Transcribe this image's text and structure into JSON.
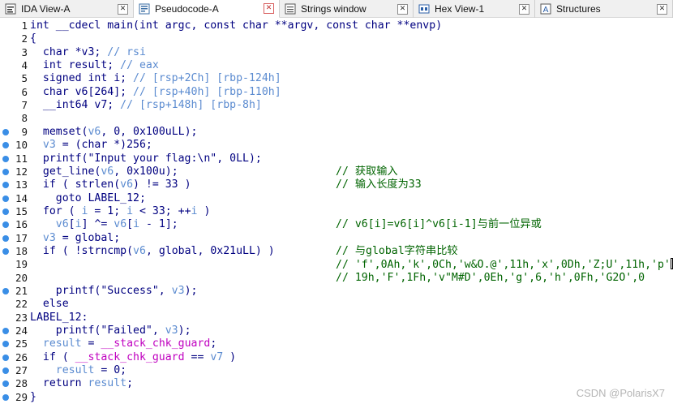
{
  "tabs": [
    {
      "label": "IDA View-A",
      "icon": "ida-view-icon",
      "close": "✕",
      "active": false
    },
    {
      "label": "Pseudocode-A",
      "icon": "pseudocode-icon",
      "close": "✕",
      "active": true
    },
    {
      "label": "Strings window",
      "icon": "strings-icon",
      "close": "✕",
      "active": false
    },
    {
      "label": "Hex View-1",
      "icon": "hex-view-icon",
      "close": "✕",
      "active": false
    },
    {
      "label": "Structures",
      "icon": "structures-icon",
      "close": "✕",
      "active": false
    }
  ],
  "code": {
    "lines": [
      {
        "n": "1",
        "bp": false,
        "parts": [
          [
            "kw",
            "int __cdecl main(int argc, const char **argv, const char **envp)"
          ]
        ]
      },
      {
        "n": "2",
        "bp": false,
        "parts": [
          [
            "kw",
            "{"
          ]
        ]
      },
      {
        "n": "3",
        "bp": false,
        "parts": [
          [
            "kw",
            "  char *v3; "
          ],
          [
            "cm",
            "// rsi"
          ]
        ]
      },
      {
        "n": "4",
        "bp": false,
        "parts": [
          [
            "kw",
            "  int result; "
          ],
          [
            "cm",
            "// eax"
          ]
        ]
      },
      {
        "n": "5",
        "bp": false,
        "parts": [
          [
            "kw",
            "  signed int i; "
          ],
          [
            "cm",
            "// [rsp+2Ch] [rbp-124h]"
          ]
        ]
      },
      {
        "n": "6",
        "bp": false,
        "parts": [
          [
            "kw",
            "  char v6[264]; "
          ],
          [
            "cm",
            "// [rsp+40h] [rbp-110h]"
          ]
        ]
      },
      {
        "n": "7",
        "bp": false,
        "parts": [
          [
            "kw",
            "  __int64 v7; "
          ],
          [
            "cm",
            "// [rsp+148h] [rbp-8h]"
          ]
        ]
      },
      {
        "n": "8",
        "bp": false,
        "parts": [
          [
            "kw",
            ""
          ]
        ]
      },
      {
        "n": "9",
        "bp": true,
        "parts": [
          [
            "kw",
            "  memset("
          ],
          [
            "var",
            "v6"
          ],
          [
            "kw",
            ", 0, 0x100uLL);"
          ]
        ]
      },
      {
        "n": "10",
        "bp": true,
        "parts": [
          [
            "kw",
            "  "
          ],
          [
            "var",
            "v3"
          ],
          [
            "kw",
            " = (char *)256;"
          ]
        ]
      },
      {
        "n": "11",
        "bp": true,
        "parts": [
          [
            "kw",
            "  printf(\"Input your flag:\\n\", 0LL);"
          ]
        ]
      },
      {
        "n": "12",
        "bp": true,
        "parts": [
          [
            "kw",
            "  get_line("
          ],
          [
            "var",
            "v6"
          ],
          [
            "kw",
            ", 0x100u);"
          ]
        ],
        "comment": "// 获取输入"
      },
      {
        "n": "13",
        "bp": true,
        "parts": [
          [
            "kw",
            "  if ( strlen("
          ],
          [
            "var",
            "v6"
          ],
          [
            "kw",
            ") != 33 )"
          ]
        ],
        "comment": "// 输入长度为33"
      },
      {
        "n": "14",
        "bp": true,
        "parts": [
          [
            "kw",
            "    goto LABEL_12;"
          ]
        ]
      },
      {
        "n": "15",
        "bp": true,
        "parts": [
          [
            "kw",
            "  for ( "
          ],
          [
            "var",
            "i"
          ],
          [
            "kw",
            " = 1; "
          ],
          [
            "var",
            "i"
          ],
          [
            "kw",
            " < 33; ++"
          ],
          [
            "var",
            "i"
          ],
          [
            "kw",
            " )"
          ]
        ]
      },
      {
        "n": "16",
        "bp": true,
        "parts": [
          [
            "kw",
            "    "
          ],
          [
            "var",
            "v6"
          ],
          [
            "kw",
            "["
          ],
          [
            "var",
            "i"
          ],
          [
            "kw",
            "] ^= "
          ],
          [
            "var",
            "v6"
          ],
          [
            "kw",
            "["
          ],
          [
            "var",
            "i"
          ],
          [
            "kw",
            " - 1];"
          ]
        ],
        "comment": "// v6[i]=v6[i]^v6[i-1]与前一位异或"
      },
      {
        "n": "17",
        "bp": true,
        "parts": [
          [
            "kw",
            "  "
          ],
          [
            "var",
            "v3"
          ],
          [
            "kw",
            " = global;"
          ]
        ]
      },
      {
        "n": "18",
        "bp": true,
        "parts": [
          [
            "kw",
            "  if ( !strncmp("
          ],
          [
            "var",
            "v6"
          ],
          [
            "kw",
            ", global, 0x21uLL) )"
          ]
        ],
        "comment": "// 与global字符串比较"
      },
      {
        "n": "19",
        "bp": false,
        "parts": [
          [
            "kw",
            ""
          ]
        ],
        "comment": "// 'f',0Ah,'k',0Ch,'w&O.@',11h,'x',0Dh,'Z;U',11h,'p'",
        "cursor": true
      },
      {
        "n": "20",
        "bp": false,
        "parts": [
          [
            "kw",
            ""
          ]
        ],
        "comment": "// 19h,'F',1Fh,'v\"M#D',0Eh,'g',6,'h',0Fh,'G2O',0"
      },
      {
        "n": "21",
        "bp": true,
        "parts": [
          [
            "kw",
            "    printf(\"Success\", "
          ],
          [
            "var",
            "v3"
          ],
          [
            "kw",
            ");"
          ]
        ]
      },
      {
        "n": "22",
        "bp": false,
        "parts": [
          [
            "kw",
            "  else"
          ]
        ]
      },
      {
        "n": "23",
        "bp": false,
        "parts": [
          [
            "kw",
            "LABEL_12:"
          ]
        ]
      },
      {
        "n": "24",
        "bp": true,
        "parts": [
          [
            "kw",
            "    printf(\"Failed\", "
          ],
          [
            "var",
            "v3"
          ],
          [
            "kw",
            ");"
          ]
        ]
      },
      {
        "n": "25",
        "bp": true,
        "parts": [
          [
            "kw",
            "  "
          ],
          [
            "var",
            "result"
          ],
          [
            "kw",
            " = "
          ],
          [
            "gv",
            "__stack_chk_guard"
          ],
          [
            "kw",
            ";"
          ]
        ]
      },
      {
        "n": "26",
        "bp": true,
        "parts": [
          [
            "kw",
            "  if ( "
          ],
          [
            "gv",
            "__stack_chk_guard"
          ],
          [
            "kw",
            " == "
          ],
          [
            "var",
            "v7"
          ],
          [
            "kw",
            " )"
          ]
        ]
      },
      {
        "n": "27",
        "bp": true,
        "parts": [
          [
            "kw",
            "    "
          ],
          [
            "var",
            "result"
          ],
          [
            "kw",
            " = 0;"
          ]
        ]
      },
      {
        "n": "28",
        "bp": true,
        "parts": [
          [
            "kw",
            "  return "
          ],
          [
            "var",
            "result"
          ],
          [
            "kw",
            ";"
          ]
        ]
      },
      {
        "n": "29",
        "bp": true,
        "parts": [
          [
            "kw",
            "}"
          ]
        ]
      }
    ]
  },
  "watermark": "CSDN @PolarisX7",
  "colors": {
    "keyword": "#000080",
    "variable": "#5b8bd0",
    "global": "#c000c0",
    "comment": "#006400",
    "breakpoint": "#3a8ee6"
  }
}
